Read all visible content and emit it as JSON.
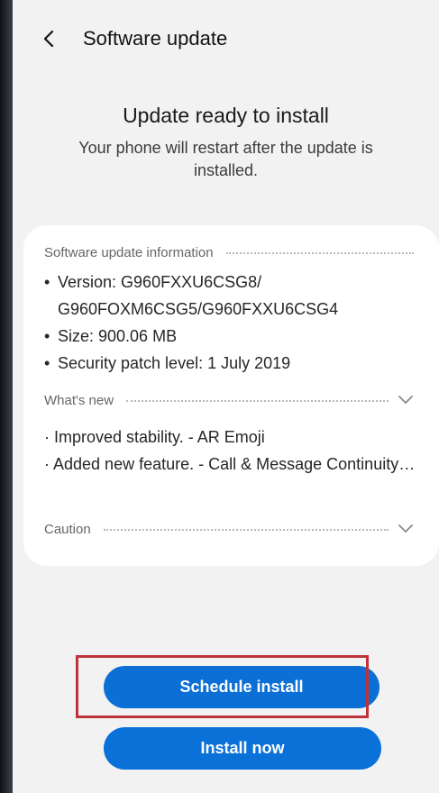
{
  "header": {
    "title": "Software update"
  },
  "status": {
    "title": "Update ready to install",
    "subtitle": "Your phone will restart after the update is installed."
  },
  "info": {
    "label": "Software update information",
    "items": [
      "Version: G960FXXU6CSG8/ G960FOXM6CSG5/G960FXXU6CSG4",
      "Size: 900.06 MB",
      "Security patch level: 1 July 2019"
    ]
  },
  "whats_new": {
    "label": "What's new",
    "lines": [
      "· Improved stability. - AR Emoji",
      "· Added new feature. - Call & Message Continuity…"
    ]
  },
  "caution": {
    "label": "Caution"
  },
  "buttons": {
    "schedule": "Schedule install",
    "install_now": "Install now"
  },
  "colors": {
    "accent": "#0a71d9",
    "highlight": "#c0323a",
    "background": "#f2f2f2",
    "card": "#ffffff"
  },
  "icons": {
    "back": "back-arrow-icon",
    "expand": "chevron-down-icon"
  }
}
